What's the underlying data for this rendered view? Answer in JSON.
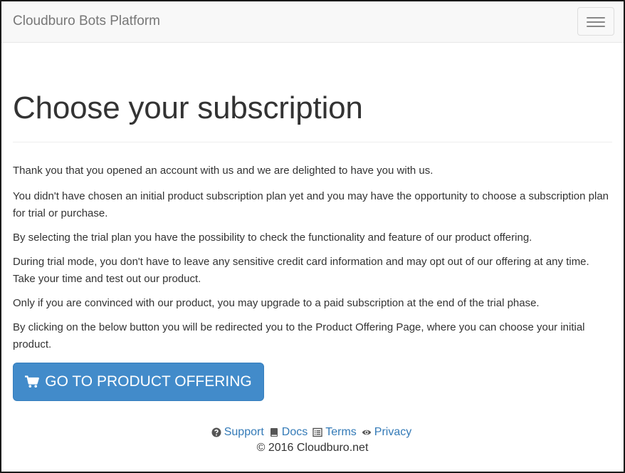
{
  "navbar": {
    "brand": "Cloudburo Bots Platform"
  },
  "page": {
    "title": "Choose your subscription",
    "paragraphs": [
      "Thank you that you opened an account with us and we are delighted to have you with us.",
      "You didn't have chosen an initial product subscription plan yet and you may have the opportunity to choose a subscription plan for trial or purchase.",
      "By selecting the trial plan you have the possibility to check the functionality and feature of our product offering.",
      "During trial mode, you don't have to leave any sensitive credit card information and may opt out of our offering at any time. Take your time and test out our product.",
      "Only if you are convinced with our product, you may upgrade to a paid subscription at the end of the trial phase.",
      "By clicking on the below button you will be redirected you to the Product Offering Page, where you can choose your initial product."
    ],
    "button_label": "GO TO PRODUCT OFFERING"
  },
  "footer": {
    "links": {
      "support": "Support",
      "docs": "Docs",
      "terms": "Terms",
      "privacy": "Privacy"
    },
    "copyright": "© 2016 Cloudburo.net"
  },
  "colors": {
    "primary": "#428bca",
    "link": "#337ab7",
    "navbar_bg": "#f8f8f8",
    "brand_text": "#777777"
  },
  "icons": {
    "menu": "hamburger-icon",
    "button": "shopping-cart-icon",
    "support": "question-circle-icon",
    "docs": "book-icon",
    "terms": "list-alt-icon",
    "privacy": "eye-icon"
  }
}
